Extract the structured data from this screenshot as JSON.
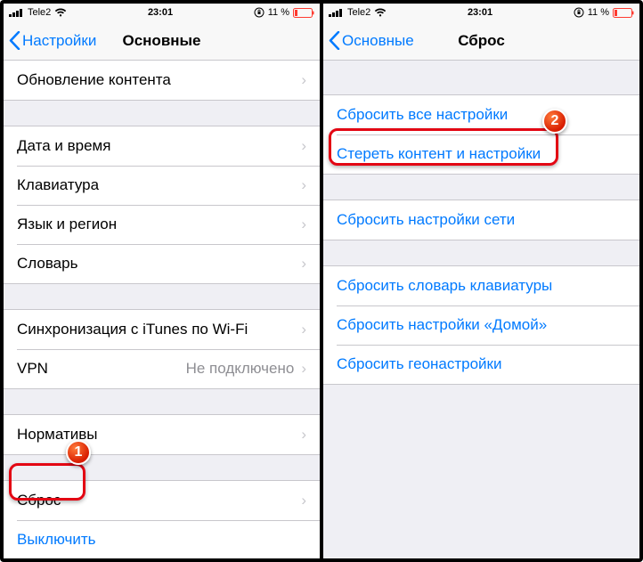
{
  "status": {
    "carrier": "Tele2",
    "time": "23:01",
    "battery_pct": "11 %"
  },
  "left": {
    "back": "Настройки",
    "title": "Основные",
    "g1": {
      "r1": "Обновление контента"
    },
    "g2": {
      "r1": "Дата и время",
      "r2": "Клавиатура",
      "r3": "Язык и регион",
      "r4": "Словарь"
    },
    "g3": {
      "r1": "Синхронизация с iTunes по Wi-Fi",
      "r2_label": "VPN",
      "r2_value": "Не подключено"
    },
    "g4": {
      "r1": "Нормативы"
    },
    "g5": {
      "r1": "Сброс",
      "r2": "Выключить"
    },
    "badge": "1"
  },
  "right": {
    "back": "Основные",
    "title": "Сброс",
    "g1": {
      "r1": "Сбросить все настройки",
      "r2": "Стереть контент и настройки"
    },
    "g2": {
      "r1": "Сбросить настройки сети"
    },
    "g3": {
      "r1": "Сбросить словарь клавиатуры",
      "r2": "Сбросить настройки «Домой»",
      "r3": "Сбросить геонастройки"
    },
    "badge": "2"
  }
}
